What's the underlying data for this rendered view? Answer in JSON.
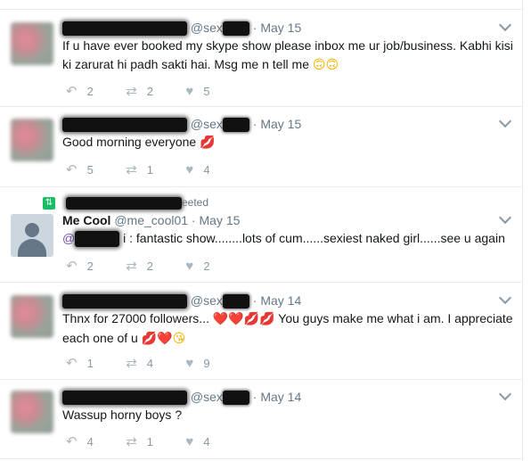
{
  "tweets": [
    {
      "handle": "@sex",
      "date": "May 15",
      "text_before": "If u have ever booked my skype show please inbox me ur job/business. Kabhi kisi ki zarurat hi padh sakti hai. Msg me n tell me",
      "emojis": [
        "🙃",
        "🙃"
      ],
      "reply_count": "2",
      "retweet_count": "2",
      "like_count": "5"
    },
    {
      "handle": "@sex",
      "date": "May 15",
      "text_before": "Good morning everyone",
      "emojis": [
        "💋"
      ],
      "reply_count": "5",
      "retweet_count": "1",
      "like_count": "4"
    },
    {
      "retweeted_label": "eeted",
      "name": "Me Cool",
      "handle": "@me_cool01",
      "date": "May 15",
      "mention_prefix": "@",
      "text_before": "i : fantastic show........lots of cum......sexiest naked girl......see u again",
      "reply_count": "2",
      "retweet_count": "2",
      "like_count": "2"
    },
    {
      "handle": "@sex",
      "date": "May 14",
      "text_before": "Thnx for 27000 followers...",
      "emojis_mid": [
        "❤️",
        "❤️",
        "💋",
        "💋"
      ],
      "text_after": "You guys make me what i am. I appreciate each one of u",
      "emojis_end": [
        "💋",
        "❤️",
        "😘"
      ],
      "reply_count": "1",
      "retweet_count": "4",
      "like_count": "9"
    },
    {
      "handle": "@sex",
      "date": "May 14",
      "text_before": "Wassup horny boys ?",
      "reply_count": "4",
      "retweet_count": "1",
      "like_count": "4"
    }
  ],
  "icons": {
    "reply": "↶",
    "retweet": "⇄",
    "like": "♥",
    "retweet_badge": "⇅"
  },
  "colors": {
    "icon_gray": "#aab8c2",
    "handle_gray": "#657786",
    "retweet_green": "#17bf63",
    "mention_purple": "#7b4db5"
  }
}
